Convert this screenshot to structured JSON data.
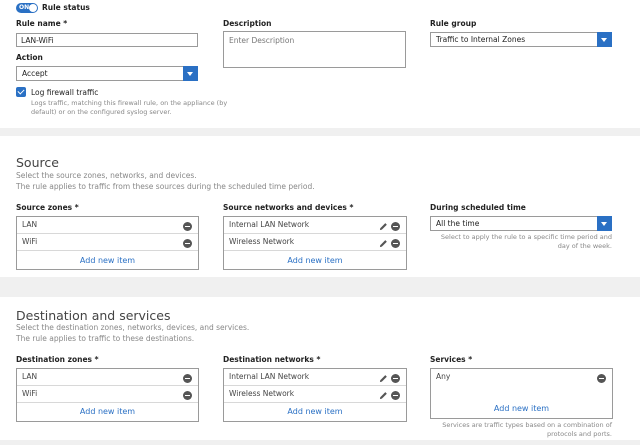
{
  "rule_status": {
    "toggle_label": "ON",
    "label": "Rule status"
  },
  "rule_name": {
    "label": "Rule name *",
    "value": "LAN-WiFi"
  },
  "description": {
    "label": "Description",
    "placeholder": "Enter Description"
  },
  "rule_group": {
    "label": "Rule group",
    "value": "Traffic to Internal Zones"
  },
  "action": {
    "label": "Action",
    "value": "Accept"
  },
  "log_traffic": {
    "label": "Log firewall traffic",
    "help_line1": "Logs traffic, matching this firewall rule, on the appliance (by",
    "help_line2": "default) or on the configured syslog server."
  },
  "source": {
    "title": "Source",
    "sub1": "Select the source zones, networks, and devices.",
    "sub2": "The rule applies to traffic from these sources during the scheduled time period.",
    "zones": {
      "label": "Source zones *",
      "items": [
        "LAN",
        "WiFi"
      ],
      "add": "Add new item"
    },
    "networks": {
      "label": "Source networks and devices *",
      "items": [
        "Internal LAN Network",
        "Wireless Network"
      ],
      "add": "Add new item"
    },
    "schedule": {
      "label": "During scheduled time",
      "value": "All the time",
      "help_line1": "Select to apply the rule to a specific time period and",
      "help_line2": "day of the week."
    }
  },
  "destination": {
    "title": "Destination and services",
    "sub1": "Select the destination zones, networks, devices, and services.",
    "sub2": "The rule applies to traffic to these destinations.",
    "zones": {
      "label": "Destination zones *",
      "items": [
        "LAN",
        "WiFi"
      ],
      "add": "Add new item"
    },
    "networks": {
      "label": "Destination networks *",
      "items": [
        "Internal LAN Network",
        "Wireless Network"
      ],
      "add": "Add new item"
    },
    "services": {
      "label": "Services *",
      "items": [
        "Any"
      ],
      "add": "Add new item",
      "help_line1": "Services are traffic types based on a combination of",
      "help_line2": "protocols and ports."
    }
  },
  "colors": {
    "accent": "#2a70c4",
    "icon": "#555555",
    "section_bg": "#f0f0f0"
  }
}
